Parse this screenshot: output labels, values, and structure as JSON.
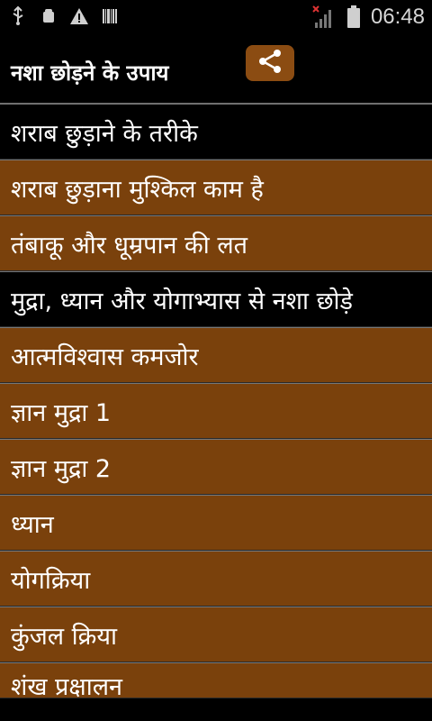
{
  "status_bar": {
    "time": "06:48",
    "left_icons": [
      "usb-icon",
      "android-debug-icon",
      "warning-icon",
      "barcode-icon"
    ],
    "right_icons": [
      "signal-off-icon",
      "battery-icon"
    ]
  },
  "header": {
    "title": "नशा छोड़ने के उपाय",
    "share_icon": "share-icon"
  },
  "list": [
    {
      "label": "शराब छुड़ाने के तरीके",
      "style": "black"
    },
    {
      "label": "शराब छुड़ाना मुश्किल काम है",
      "style": "brown"
    },
    {
      "label": "तंबाकू और धूम्रपान की लत",
      "style": "brown"
    },
    {
      "label": "मुद्रा, ध्यान और योगाभ्यास से नशा छोड़े",
      "style": "black"
    },
    {
      "label": "आत्मविश्वास कमजोर",
      "style": "brown"
    },
    {
      "label": "ज्ञान मुद्रा 1",
      "style": "brown"
    },
    {
      "label": "ज्ञान मुद्रा 2",
      "style": "brown"
    },
    {
      "label": "ध्यान",
      "style": "brown"
    },
    {
      "label": "योगक्रिया",
      "style": "brown"
    },
    {
      "label": "कुंजल क्रिया",
      "style": "brown"
    },
    {
      "label": "शंख प्रक्षालन",
      "style": "brown"
    }
  ],
  "colors": {
    "brown": "#7a410c",
    "button_brown": "#8b4c12",
    "black": "#000000"
  }
}
